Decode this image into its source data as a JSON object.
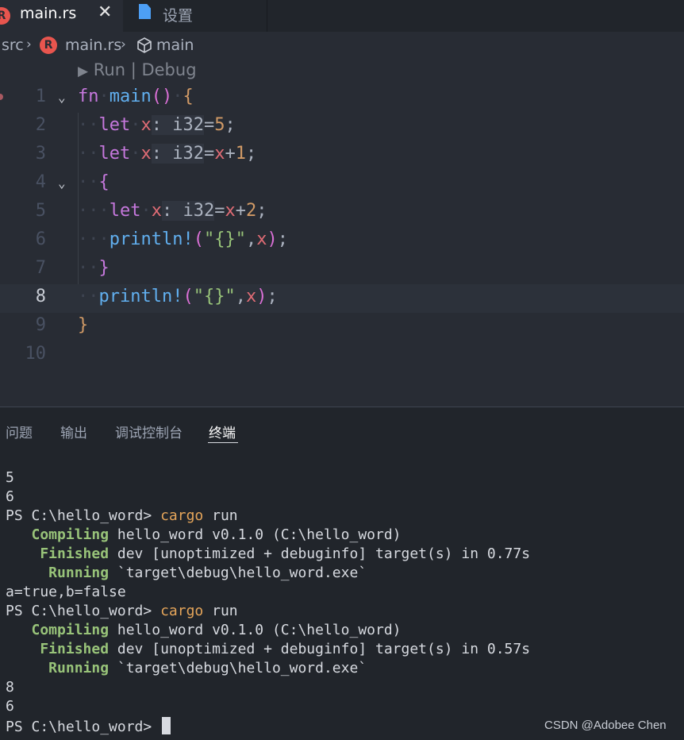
{
  "tabs": [
    {
      "label": "main.rs",
      "icon": "rust-file-icon",
      "close": "✕"
    },
    {
      "label": "设置",
      "icon": "settings-file-icon"
    }
  ],
  "breadcrumb": {
    "src": "src",
    "file": "main.rs",
    "symbol": "main"
  },
  "codelens": "Run | Debug",
  "code": {
    "line_numbers": [
      "1",
      "2",
      "3",
      "4",
      "5",
      "6",
      "7",
      "8",
      "9",
      "10"
    ],
    "current_line": "8",
    "lines": [
      {
        "kw": "fn",
        "name": "main",
        "rest": "()"
      },
      {
        "kw": "let",
        "var": "x",
        "type": "i32",
        "rhs": "5",
        "end": ";"
      },
      {
        "kw": "let",
        "var": "x",
        "type": "i32",
        "rhs_var": "x",
        "op": "+",
        "rhs": "1",
        "end": ";"
      },
      {
        "text": "{"
      },
      {
        "kw": "let",
        "var": "x",
        "type": "i32",
        "rhs_var": "x",
        "op": "+",
        "rhs": "2",
        "end": ";"
      },
      {
        "macro": "println!",
        "fmt": "\"{}\"",
        "arg": "x",
        "end": ";"
      },
      {
        "text": "}"
      },
      {
        "macro": "println!",
        "fmt": "\"{}\"",
        "arg": "x",
        "end": ";"
      },
      {
        "text": "}"
      },
      {
        "text": ""
      }
    ]
  },
  "panel": {
    "tabs": [
      "问题",
      "输出",
      "调试控制台",
      "终端"
    ],
    "active_tab": "终端"
  },
  "terminal": {
    "lines": [
      {
        "text": "5"
      },
      {
        "text": "6"
      },
      {
        "prompt": "PS C:\\hello_word> ",
        "cmd": "cargo",
        "args": " run"
      },
      {
        "status": "   Compiling",
        "rest": " hello_word v0.1.0 (C:\\hello_word)"
      },
      {
        "status": "    Finished",
        "rest": " dev [unoptimized + debuginfo] target(s) in 0.77s"
      },
      {
        "status": "     Running",
        "rest": " `target\\debug\\hello_word.exe`"
      },
      {
        "text": "a=true,b=false"
      },
      {
        "prompt": "PS C:\\hello_word> ",
        "cmd": "cargo",
        "args": " run"
      },
      {
        "status": "   Compiling",
        "rest": " hello_word v0.1.0 (C:\\hello_word)"
      },
      {
        "status": "    Finished",
        "rest": " dev [unoptimized + debuginfo] target(s) in 0.57s"
      },
      {
        "status": "     Running",
        "rest": " `target\\debug\\hello_word.exe`"
      },
      {
        "text": "8"
      },
      {
        "text": "6"
      },
      {
        "prompt": "PS C:\\hello_word> "
      }
    ]
  },
  "watermark": "CSDN @Adobee Chen",
  "colors": {
    "bg": "#282c34",
    "keyword": "#c678dd",
    "function": "#61afef",
    "variable": "#e06c75",
    "number": "#d19a66",
    "string": "#98c379",
    "status_green": "#98c379",
    "command_orange": "#e5a55a"
  }
}
